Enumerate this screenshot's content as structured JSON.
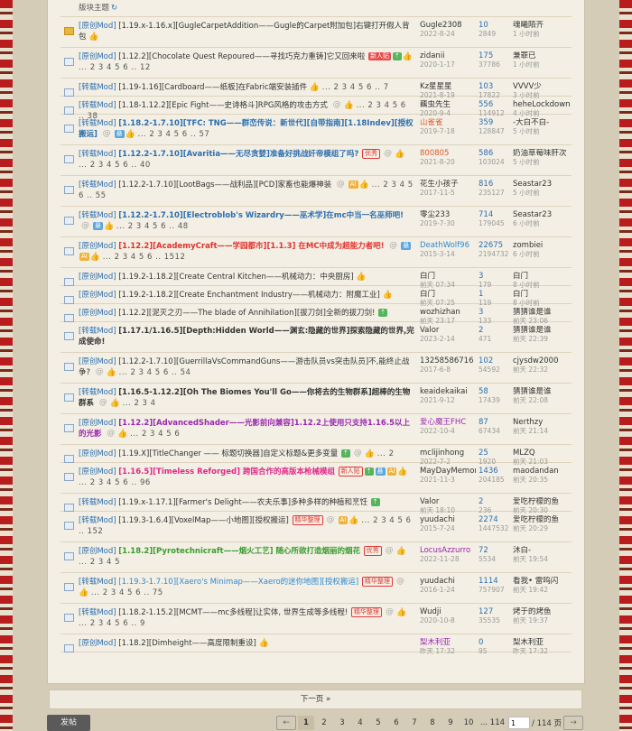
{
  "section_title": "版块主题",
  "refresh_icon": "refresh-icon",
  "threads": [
    {
      "icon": "folder",
      "type": "[原创Mod]",
      "title": "[1.19.x-1.16.x][GugleCarpetAddition——Gugle的Carpet附加包]右键打开假人背包",
      "style": "normal",
      "tags": [
        {
          "t": "👍",
          "c": "thumb"
        }
      ],
      "pages": "",
      "author": "Gugle2308",
      "date": "2022-8-24",
      "replies": "10",
      "views": "2849",
      "last_user": "魂曦陌齐",
      "last_time": "1 小时前"
    },
    {
      "icon": "doc",
      "type": "[原创Mod]",
      "title": "[1.12.2][Chocolate Quest Repoured——寻找巧克力重铸]它又回来啦",
      "style": "normal",
      "tags": [
        {
          "t": "新人贴",
          "c": "tag-red"
        },
        {
          "t": "⇡",
          "c": "tag-green"
        },
        {
          "t": "👍",
          "c": "thumb"
        }
      ],
      "pages": "... 2 3 4 5 6 .. 12",
      "author": "zidanii",
      "date": "2020-1-17",
      "replies": "175",
      "views": "37786",
      "last_user": "兼罪已",
      "last_time": "1 小时前"
    },
    {
      "icon": "doc",
      "type": "[转载Mod]",
      "title": "[1.19-1.16][Cardboard——纸板]在Fabric端安装插件",
      "style": "normal",
      "tags": [
        {
          "t": "👍",
          "c": "thumb"
        }
      ],
      "pages": "... 2 3 4 5 6 .. 7",
      "author": "Kz星星星",
      "date": "2021-8-19",
      "replies": "103",
      "views": "17822",
      "last_user": "VVVV少",
      "last_time": "3 小时前"
    },
    {
      "icon": "doc",
      "type": "[转载Mod]",
      "title": "[1.18-1.12.2][Epic Fight——史诗格斗]RPG风格的攻击方式",
      "style": "normal",
      "tags": [
        {
          "t": "@",
          "c": "tag-gray"
        },
        {
          "t": "👍",
          "c": "thumb"
        }
      ],
      "pages": "... 2 3 4 5 6 .. 38",
      "author": "藕虫先生",
      "date": "2020-9-4",
      "replies": "556",
      "views": "114912",
      "last_user": "heheLockdown",
      "last_time": "4 小时前"
    },
    {
      "icon": "doc",
      "type": "[转载Mod]",
      "title": "[1.18.2-1.7.10][TFC: TNG——群峦传说：新世代][自带指南][1.18Indev][授权搬运]",
      "style": "blue",
      "tags": [
        {
          "t": "@",
          "c": "tag-gray"
        },
        {
          "t": "悬",
          "c": "tag-blue"
        },
        {
          "t": "👍",
          "c": "thumb"
        }
      ],
      "pages": "... 2 3 4 5 6 .. 57",
      "author": "山雀雀",
      "date": "2019-7-18",
      "replies": "359",
      "views": "128847",
      "last_user": "-大白不白-",
      "last_time": "5 小时前"
    },
    {
      "icon": "doc",
      "type": "[转载Mod]",
      "title": "[1.12.2-1.7.10][Avaritia——无尽贪婪]准备好挑战奸帝模组了吗?",
      "style": "lightblue-bold",
      "tags": [
        {
          "t": "优秀",
          "c": "tag-outline"
        },
        {
          "t": "@",
          "c": "tag-gray"
        },
        {
          "t": "👍",
          "c": "thumb"
        }
      ],
      "pages": "... 2 3 4 5 6 .. 40",
      "author": "800805",
      "date": "2021-8-20",
      "replies": "586",
      "views": "103024",
      "last_user": "奶油草莓味肝次",
      "last_time": "5 小时前"
    },
    {
      "icon": "doc",
      "type": "[转载Mod]",
      "title": "[1.12.2-1.7.10][LootBags——战利品][PCD]家畜也能爆神装",
      "style": "normal",
      "tags": [
        {
          "t": "@",
          "c": "tag-gray"
        },
        {
          "t": "AI",
          "c": "tag-yellow"
        },
        {
          "t": "👍",
          "c": "thumb"
        }
      ],
      "pages": "... 2 3 4 5 6 .. 55",
      "author": "花生小孩子",
      "date": "2017-11-5",
      "replies": "816",
      "views": "235127",
      "last_user": "Seastar23",
      "last_time": "5 小时前"
    },
    {
      "icon": "doc",
      "type": "[转载Mod]",
      "title": "[1.12.2-1.7.10][Electroblob's Wizardry——巫术学]在mc中当一名巫师吧!",
      "style": "blue",
      "tags": [
        {
          "t": "@",
          "c": "tag-gray"
        },
        {
          "t": "悬",
          "c": "tag-blue"
        },
        {
          "t": "👍",
          "c": "thumb"
        }
      ],
      "pages": "... 2 3 4 5 6 .. 48",
      "author": "零尘233",
      "date": "2019-7-30",
      "replies": "714",
      "views": "179045",
      "last_user": "Seastar23",
      "last_time": "6 小时前"
    },
    {
      "icon": "doc",
      "type": "[原创Mod]",
      "title": "[1.12.2][AcademyCraft——学园都市][1.1.3] 在MC中成为超能力者吧!",
      "style": "red",
      "tags": [
        {
          "t": "@",
          "c": "tag-gray"
        },
        {
          "t": "悬",
          "c": "tag-blue"
        },
        {
          "t": "AI",
          "c": "tag-yellow"
        },
        {
          "t": "👍",
          "c": "thumb"
        }
      ],
      "pages": "... 2 3 4 5 6 .. 1512",
      "author": "DeathWolf96",
      "date": "2015-3-14",
      "replies": "22675",
      "views": "2194732",
      "last_user": "zombiei",
      "last_time": "6 小时前"
    },
    {
      "icon": "doc",
      "type": "[原创Mod]",
      "title": "[1.19.2-1.18.2][Create Central Kitchen——机械动力：中央厨房]",
      "style": "normal",
      "tags": [
        {
          "t": "👍",
          "c": "thumb"
        }
      ],
      "pages": "",
      "author": "白门",
      "date": "前天 07:34",
      "replies": "3",
      "views": "179",
      "last_user": "白门",
      "last_time": "8 小时前"
    },
    {
      "icon": "doc",
      "type": "[原创Mod]",
      "title": "[1.19.2-1.18.2][Create Enchantment Industry——机械动力：附魔工业]",
      "style": "normal",
      "tags": [
        {
          "t": "👍",
          "c": "thumb"
        }
      ],
      "pages": "",
      "author": "白门",
      "date": "前天 07:25",
      "replies": "1",
      "views": "119",
      "last_user": "白门",
      "last_time": "8 小时前"
    },
    {
      "icon": "doc",
      "type": "[原创Mod]",
      "title": "[1.12.2][泥灭之刃——The blade of Annihilation][拔刀剑]全新的拔刀剑!",
      "style": "normal",
      "tags": [
        {
          "t": "⇡",
          "c": "tag-green"
        }
      ],
      "pages": "",
      "author": "wozhizhan",
      "date": "前天 23:17",
      "replies": "3",
      "views": "133",
      "last_user": "猜猜谁是谁",
      "last_time": "前天 23:06"
    },
    {
      "icon": "doc",
      "type": "[转载Mod]",
      "title": "[1.17.1/1.16.5][Depth:Hidden World——渊玄:隐藏的世界]探索隐藏的世界,完成使命!",
      "style": "bold",
      "tags": [],
      "pages": "",
      "author": "Valor",
      "date": "2023-2-14",
      "replies": "2",
      "views": "471",
      "last_user": "猜猜谁是谁",
      "last_time": "前天 22:39"
    },
    {
      "icon": "doc",
      "type": "[原创Mod]",
      "title": "[1.12.2-1.7.10][GuerrillaVsCommandGuns——游击队员vs突击队员]不,能终止战争?",
      "style": "normal",
      "tags": [
        {
          "t": "@",
          "c": "tag-gray"
        },
        {
          "t": "👍",
          "c": "thumb"
        }
      ],
      "pages": "... 2 3 4 5 6 .. 54",
      "author": "13258586716",
      "date": "2017-6-8",
      "replies": "102",
      "views": "54592",
      "last_user": "cjysdw2000",
      "last_time": "前天 22:32"
    },
    {
      "icon": "doc",
      "type": "[转载Mod]",
      "title": "[1.16.5-1.12.2][Oh The Biomes You'll Go——你将去的生物群系]超棒的生物群系",
      "style": "bold",
      "tags": [
        {
          "t": "@",
          "c": "tag-gray"
        },
        {
          "t": "👍",
          "c": "thumb"
        }
      ],
      "pages": "... 2 3 4",
      "author": "keaidekaikai",
      "date": "2021-9-12",
      "replies": "58",
      "views": "17439",
      "last_user": "猜猜谁是谁",
      "last_time": "前天 22:08"
    },
    {
      "icon": "doc",
      "type": "[原创Mod]",
      "title": "[1.12.2][AdvancedShader——光影前向兼容]1.12.2上使用只支持1.16.5以上的光影",
      "style": "purple",
      "tags": [
        {
          "t": "@",
          "c": "tag-gray"
        },
        {
          "t": "👍",
          "c": "thumb"
        }
      ],
      "pages": "... 2 3 4 5 6",
      "author": "爱心魔王FHC",
      "date": "2022-10-4",
      "replies": "87",
      "views": "67434",
      "last_user": "Nerthzy",
      "last_time": "前天 21:14"
    },
    {
      "icon": "doc",
      "type": "[原创Mod]",
      "title": "[1.19.X][TitleChanger —— 标题切换器]自定义标题&更多变量",
      "style": "normal",
      "tags": [
        {
          "t": "⇡",
          "c": "tag-green"
        },
        {
          "t": "@",
          "c": "tag-gray"
        },
        {
          "t": "👍",
          "c": "thumb"
        }
      ],
      "pages": "... 2",
      "author": "mclijinhong",
      "date": "2022-7-2",
      "replies": "25",
      "views": "1920",
      "last_user": "MLZQ",
      "last_time": "前天 21:03"
    },
    {
      "icon": "doc",
      "type": "[原创Mod]",
      "title": "[1.16.5][Timeless Reforged] 跨国合作的高版本枪械模组",
      "style": "pink",
      "tags": [
        {
          "t": "新人贴",
          "c": "tag-outline"
        },
        {
          "t": "⇡",
          "c": "tag-green"
        },
        {
          "t": "悬",
          "c": "tag-blue"
        },
        {
          "t": "AI",
          "c": "tag-yellow"
        },
        {
          "t": "👍",
          "c": "thumb"
        }
      ],
      "pages": "... 2 3 4 5 6 .. 96",
      "author": "MayDayMemory",
      "date": "2021-11-3",
      "replies": "1436",
      "views": "204185",
      "last_user": "maodandan",
      "last_time": "前天 20:35"
    },
    {
      "icon": "doc",
      "type": "[转载Mod]",
      "title": "[1.19.x-1.17.1][Farmer's Delight——农夫乐事]多种多样的种植和烹饪",
      "style": "normal",
      "tags": [
        {
          "t": "⇡",
          "c": "tag-green"
        }
      ],
      "pages": "",
      "author": "Valor",
      "date": "前天 18:10",
      "replies": "2",
      "views": "236",
      "last_user": "爱吃柠檬的鱼",
      "last_time": "前天 20:30"
    },
    {
      "icon": "doc",
      "type": "[转载Mod]",
      "title": "[1.19.3-1.6.4][VoxelMap——小地图][授权搬运]",
      "style": "normal",
      "tags": [
        {
          "t": "精华整理",
          "c": "tag-outline"
        },
        {
          "t": "@",
          "c": "tag-gray"
        },
        {
          "t": "AI",
          "c": "tag-yellow"
        },
        {
          "t": "👍",
          "c": "thumb"
        }
      ],
      "pages": "... 2 3 4 5 6 .. 152",
      "author": "yuudachi",
      "date": "2015-7-24",
      "replies": "2274",
      "views": "1447532",
      "last_user": "爱吃柠檬的鱼",
      "last_time": "前天 20:29"
    },
    {
      "icon": "doc",
      "type": "[原创Mod]",
      "title": "[1.18.2][Pyrotechnicraft——烟火工艺] 随心所欲打造烟丽的烟花",
      "style": "green",
      "tags": [
        {
          "t": "优秀",
          "c": "tag-outline"
        },
        {
          "t": "@",
          "c": "tag-gray"
        },
        {
          "t": "👍",
          "c": "thumb"
        }
      ],
      "pages": "... 2 3 4 5",
      "author": "LocusAzzurro",
      "date": "2022-11-28",
      "replies": "72",
      "views": "5534",
      "last_user": "沐白-",
      "last_time": "前天 19:54"
    },
    {
      "icon": "doc",
      "type": "[转载Mod]",
      "title": "[1.19.3-1.7.10][Xaero's Minimap——Xaero的迷你地图][授权搬运]",
      "style": "lightblue",
      "tags": [
        {
          "t": "精华整理",
          "c": "tag-outline"
        },
        {
          "t": "@",
          "c": "tag-gray"
        },
        {
          "t": "👍",
          "c": "thumb"
        }
      ],
      "pages": "... 2 3 4 5 6 .. 75",
      "author": "yuudachi",
      "date": "2016-1-24",
      "replies": "1114",
      "views": "757907",
      "last_user": "看我• 雷鸣闪",
      "last_time": "前天 19:42"
    },
    {
      "icon": "doc",
      "type": "[转载Mod]",
      "title": "[1.18.2-1.15.2][MCMT——mc多线程]让实体, 世界生成等多线程!",
      "style": "normal",
      "tags": [
        {
          "t": "精华整理",
          "c": "tag-outline"
        },
        {
          "t": "@",
          "c": "tag-gray"
        },
        {
          "t": "👍",
          "c": "thumb"
        }
      ],
      "pages": "... 2 3 4 5 6 .. 9",
      "author": "Wudji",
      "date": "2020-10-8",
      "replies": "127",
      "views": "35535",
      "last_user": "烤于的烤鱼",
      "last_time": "前天 19:37"
    },
    {
      "icon": "doc",
      "type": "[原创Mod]",
      "title": "[1.18.2][Dimheight——高度限制重设]",
      "style": "normal",
      "tags": [
        {
          "t": "👍",
          "c": "thumb"
        }
      ],
      "pages": "",
      "author": "梨木利亚",
      "date": "昨天 17:32",
      "replies": "0",
      "views": "95",
      "last_user": "梨木利亚",
      "last_time": "昨天 17:32"
    }
  ],
  "author_colors": {
    "山雀雀": "orange",
    "800805": "orange",
    "DeathWolf96": "blue",
    "爱心魔王FHC": "purple",
    "LocusAzzurro": "purple",
    "梨木利亚": "purple"
  },
  "next_page_label": "下一页 »",
  "post_button_label": "发帖",
  "pager": {
    "pages": [
      "1",
      "2",
      "3",
      "4",
      "5",
      "6",
      "7",
      "8",
      "9",
      "10",
      "... 114"
    ],
    "current": "1",
    "input_value": "1",
    "total": "/ 114 页"
  }
}
